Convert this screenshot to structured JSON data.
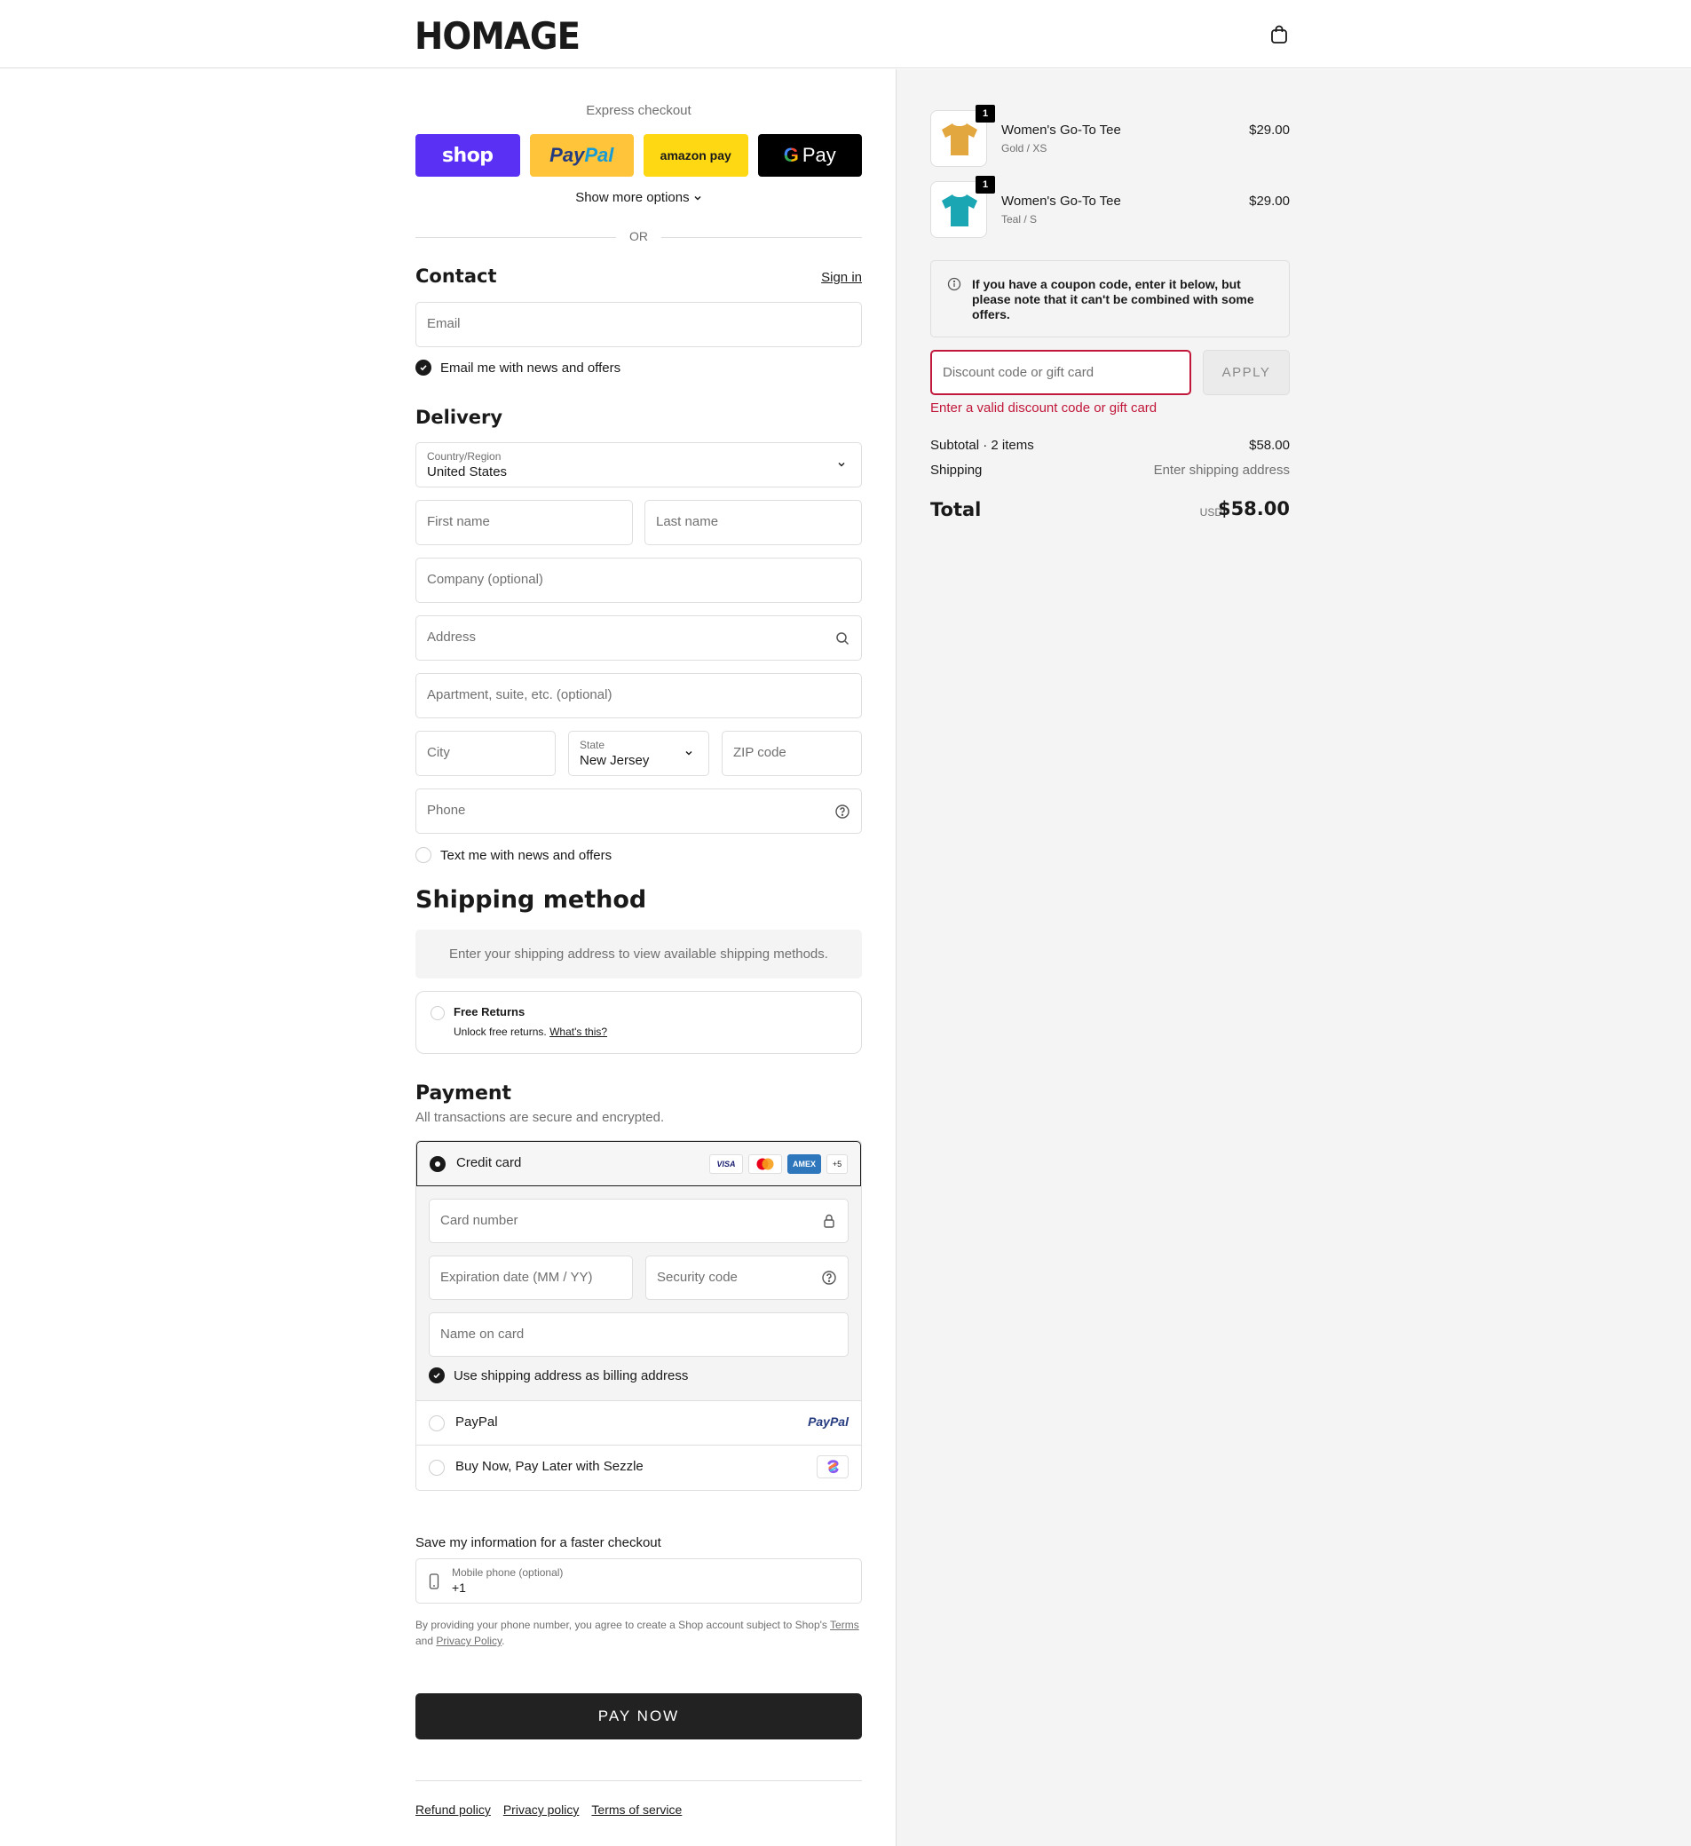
{
  "header": {
    "logo": "HOMAGE",
    "cart_icon": "shopping-bag-icon"
  },
  "express": {
    "title": "Express checkout",
    "shop_label": "shop",
    "paypal_part1": "Pay",
    "paypal_part2": "Pal",
    "amazon_label": "amazon pay",
    "gpay_g": "G",
    "gpay_label": "Pay",
    "more_options": "Show more options",
    "or": "OR"
  },
  "contact": {
    "title": "Contact",
    "sign_in": "Sign in",
    "email_placeholder": "Email",
    "email_opt_in": "Email me with news and offers"
  },
  "delivery": {
    "title": "Delivery",
    "country_label": "Country/Region",
    "country_value": "United States",
    "first_name": "First name",
    "last_name": "Last name",
    "company": "Company (optional)",
    "address": "Address",
    "apartment": "Apartment, suite, etc. (optional)",
    "city": "City",
    "state_label": "State",
    "state_value": "New Jersey",
    "zip": "ZIP code",
    "phone": "Phone",
    "sms_opt_in": "Text me with news and offers"
  },
  "shipping": {
    "title": "Shipping method",
    "notice": "Enter your shipping address to view available shipping methods.",
    "free_returns_title": "Free Returns",
    "free_returns_text": "Unlock free returns.",
    "whats_this": "What's this?"
  },
  "payment": {
    "title": "Payment",
    "subtitle": "All transactions are secure and encrypted.",
    "credit_card": "Credit card",
    "card_logos": [
      "VISA",
      "MC",
      "AMEX",
      "+5"
    ],
    "card_number": "Card number",
    "expiration": "Expiration date (MM / YY)",
    "security_code": "Security code",
    "name_on_card": "Name on card",
    "billing_same": "Use shipping address as billing address",
    "paypal": "PayPal",
    "paypal_logo": "PayPal",
    "sezzle": "Buy Now, Pay Later with Sezzle"
  },
  "save_info": {
    "title": "Save my information for a faster checkout",
    "mobile_label": "Mobile phone (optional)",
    "mobile_prefix": "+1",
    "terms_prefix": "By providing your phone number, you agree to create a Shop account subject to Shop's",
    "terms_link": "Terms",
    "terms_and": "and",
    "privacy_link": "Privacy Policy",
    "terms_end": "."
  },
  "pay_now": "PAY NOW",
  "footer": {
    "refund": "Refund policy",
    "privacy": "Privacy policy",
    "terms": "Terms of service"
  },
  "summary": {
    "items": [
      {
        "name": "Women's Go-To Tee",
        "variant": "Gold / XS",
        "price": "$29.00",
        "qty": "1",
        "color": "#e3a73f"
      },
      {
        "name": "Women's Go-To Tee",
        "variant": "Teal / S",
        "price": "$29.00",
        "qty": "1",
        "color": "#1aa6b3"
      }
    ],
    "coupon_note": "If you have a coupon code, enter it below, but please note that it can't be combined with some offers.",
    "discount_placeholder": "Discount code or gift card",
    "apply": "APPLY",
    "discount_error": "Enter a valid discount code or gift card",
    "subtotal_label": "Subtotal · 2 items",
    "subtotal_value": "$58.00",
    "shipping_label": "Shipping",
    "shipping_value": "Enter shipping address",
    "total_label": "Total",
    "currency": "USD",
    "total_value": "$58.00"
  },
  "colors": {
    "accent": "#5a31f4",
    "error": "#c1173a",
    "dark": "#222222"
  }
}
